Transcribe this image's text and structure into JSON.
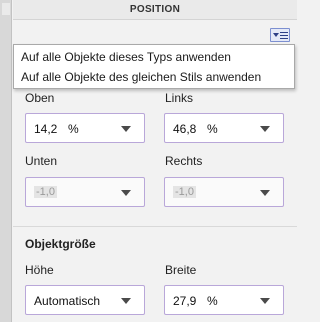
{
  "header": {
    "title": "POSITION"
  },
  "menu": {
    "items": [
      "Auf alle Objekte dieses Typs anwenden",
      "Auf alle Objekte des gleichen Stils anwenden"
    ]
  },
  "position": {
    "top": {
      "label": "Oben",
      "value": "14,2",
      "unit": "%"
    },
    "left": {
      "label": "Links",
      "value": "46,8",
      "unit": "%"
    },
    "bottom": {
      "label": "Unten",
      "value": "-1,0"
    },
    "right": {
      "label": "Rechts",
      "value": "-1,0"
    }
  },
  "size": {
    "title": "Objektgröße",
    "height": {
      "label": "Höhe",
      "value": "Automatisch"
    },
    "width": {
      "label": "Breite",
      "value": "27,9",
      "unit": "%"
    }
  }
}
